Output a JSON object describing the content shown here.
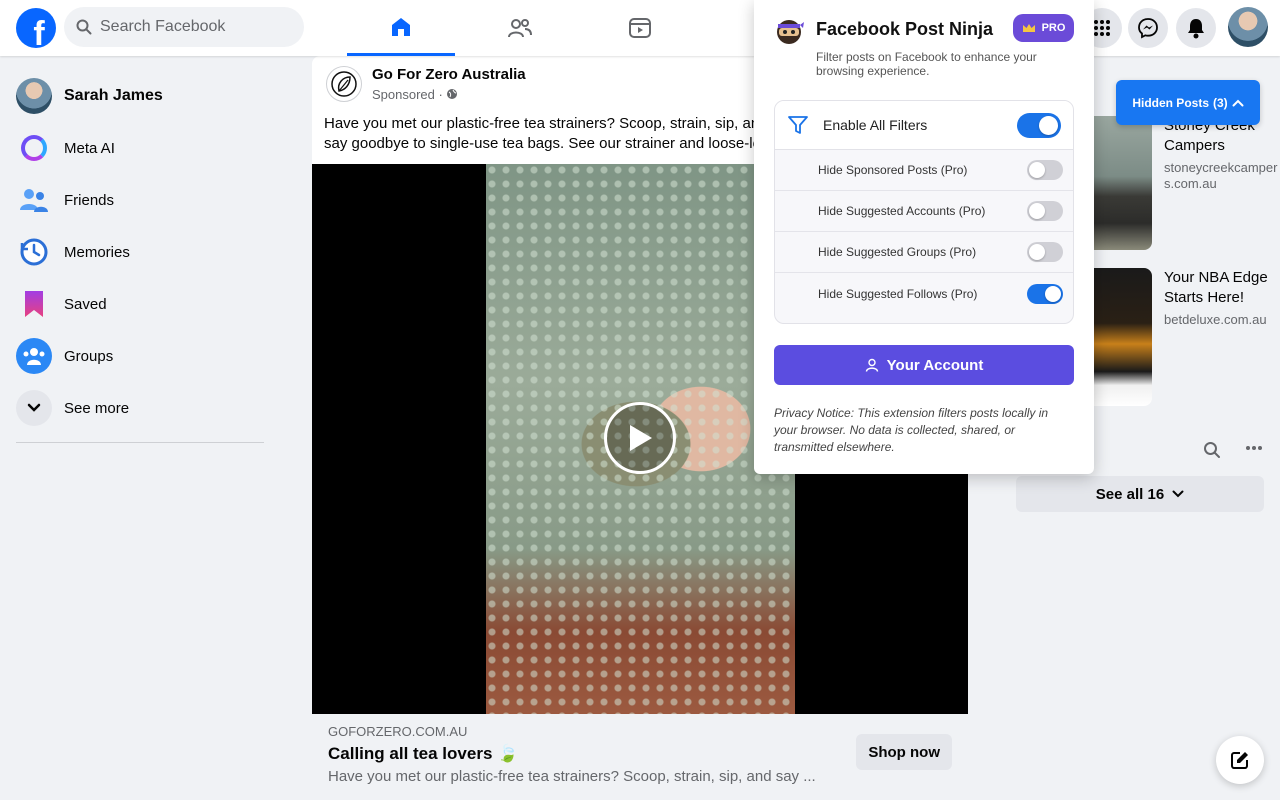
{
  "header": {
    "logo_text": "f",
    "search_placeholder": "Search Facebook"
  },
  "user": {
    "name": "Sarah James"
  },
  "sidebar": {
    "items": [
      {
        "label": "Meta AI"
      },
      {
        "label": "Friends"
      },
      {
        "label": "Memories"
      },
      {
        "label": "Saved"
      },
      {
        "label": "Groups"
      },
      {
        "label": "See more"
      }
    ]
  },
  "post": {
    "page_name": "Go For Zero Australia",
    "sponsored_label": "Sponsored ·",
    "text": "Have you met our plastic-free tea strainers? Scoop, strain, sip, and say goodbye to single-use tea bags. See our strainer and loose-leaf tea 👇🏼. Enjoy fellow tea lovers!",
    "link_domain": "GOFORZERO.COM.AU",
    "link_title": "Calling all tea lovers 🍃",
    "link_desc": "Have you met our plastic-free tea strainers? Scoop, strain, sip, and say ...",
    "cta_label": "Shop now"
  },
  "right": {
    "hidden_posts_label": "Hidden Posts",
    "hidden_posts_count": "(3)",
    "sponsors": [
      {
        "title": "Stoney Creek Campers",
        "domain": "stoneycreekcampers.com.au"
      },
      {
        "title": "Your NBA Edge Starts Here!",
        "domain": "betdeluxe.com.au"
      }
    ],
    "see_all_label": "See all 16"
  },
  "extension": {
    "title": "Facebook Post Ninja",
    "pro_label": "PRO",
    "subtitle": "Filter posts on Facebook to enhance your browsing experience.",
    "enable_all_label": "Enable All Filters",
    "enable_all_on": true,
    "filters": [
      {
        "label": "Hide Sponsored Posts (Pro)",
        "on": false
      },
      {
        "label": "Hide Suggested Accounts (Pro)",
        "on": false
      },
      {
        "label": "Hide Suggested Groups (Pro)",
        "on": false
      },
      {
        "label": "Hide Suggested Follows (Pro)",
        "on": true
      }
    ],
    "account_button": "Your Account",
    "privacy_notice": "Privacy Notice: This extension filters posts locally in your browser. No data is collected, shared, or transmitted elsewhere."
  },
  "colors": {
    "facebook_blue": "#0866ff",
    "extension_purple": "#5b4de0",
    "toggle_on": "#1a73e8"
  }
}
